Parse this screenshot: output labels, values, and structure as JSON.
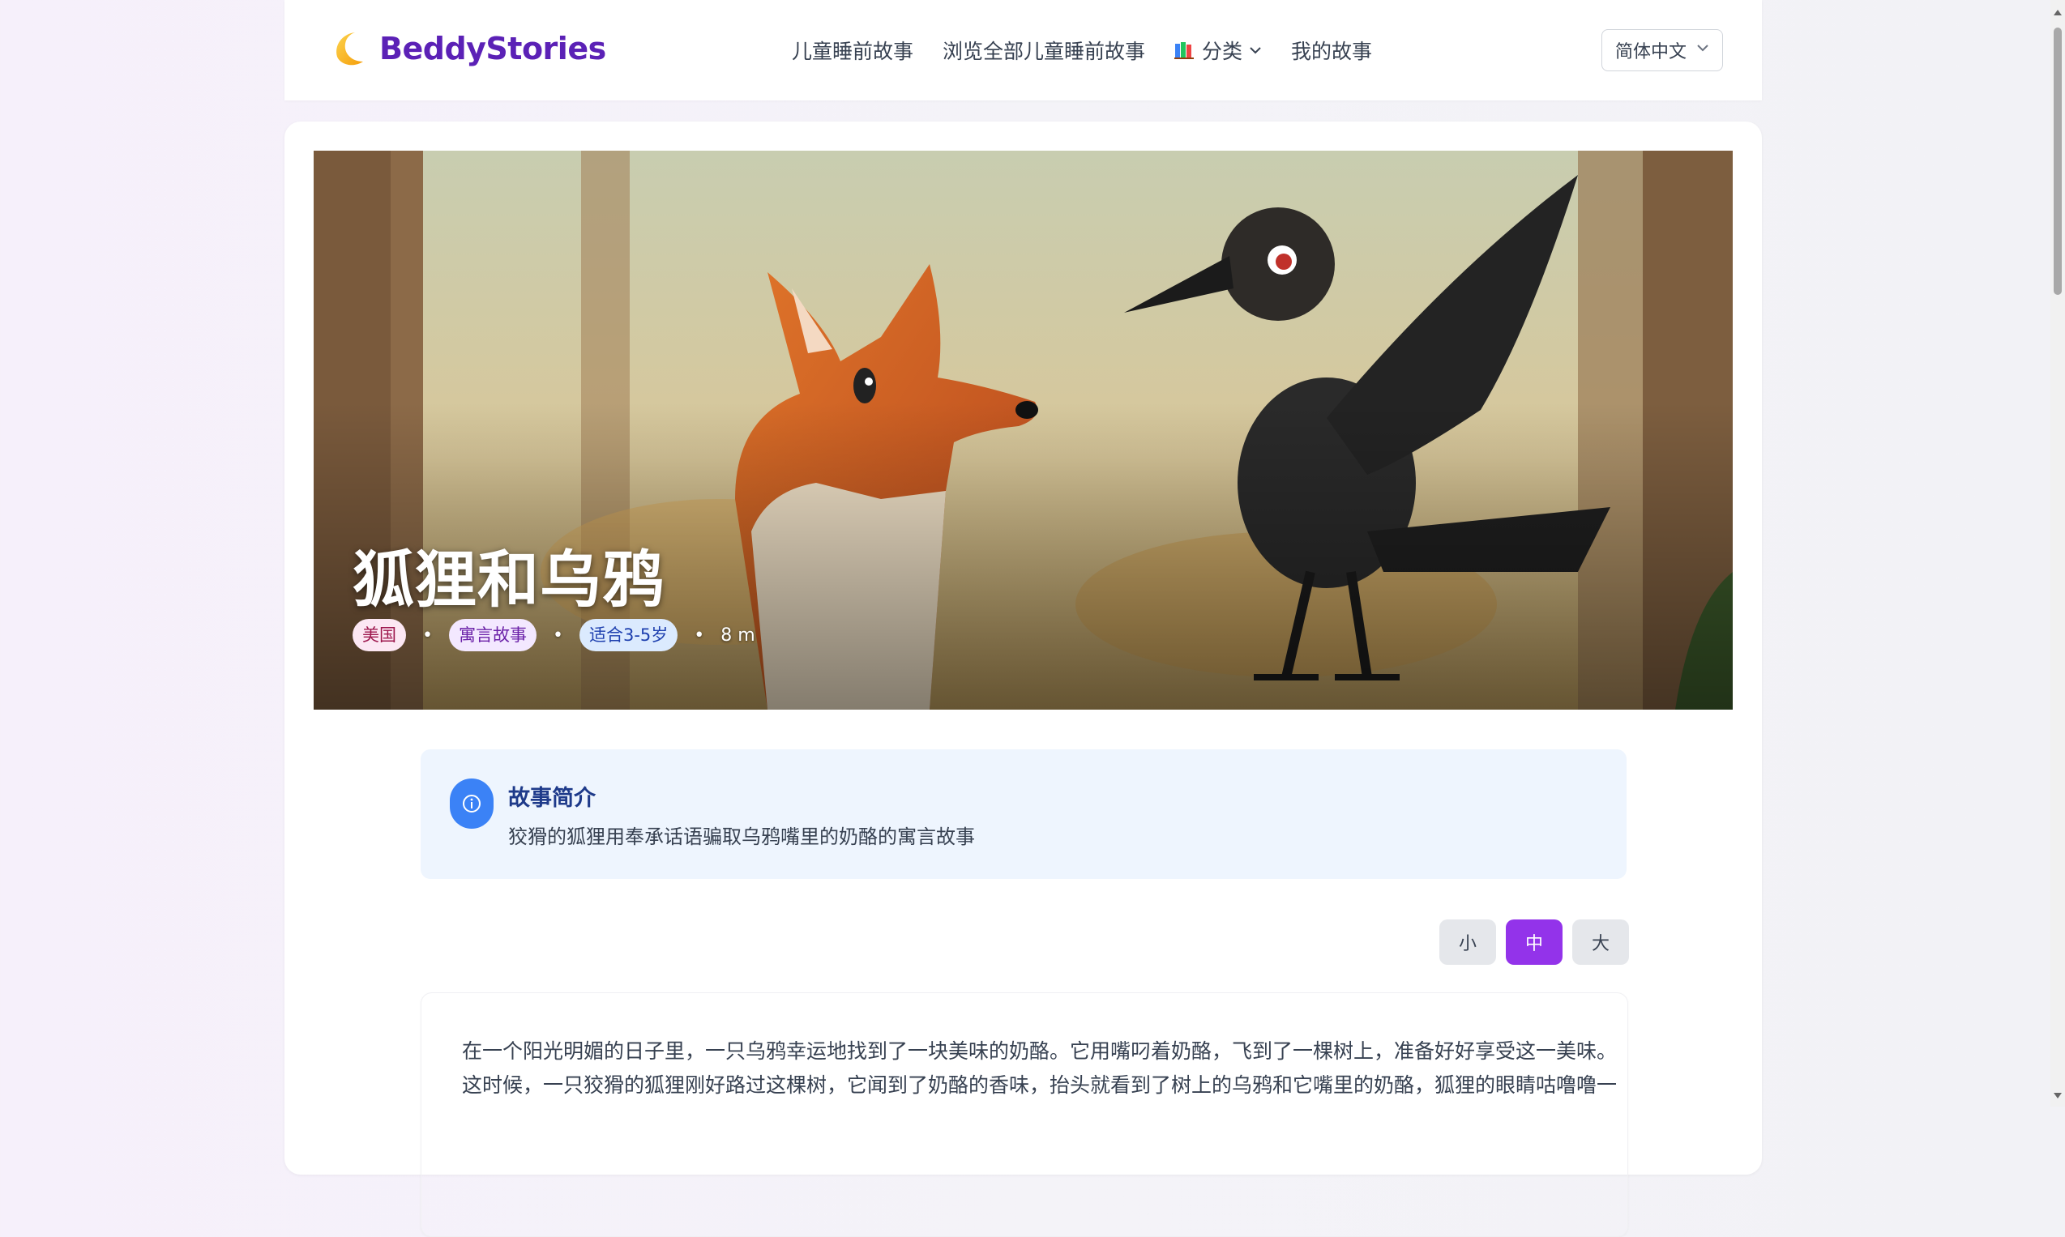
{
  "brand": {
    "name": "BeddyStories",
    "logo_icon": "crescent-moon-icon"
  },
  "nav": {
    "items": [
      {
        "label": "儿童睡前故事"
      },
      {
        "label": "浏览全部儿童睡前故事"
      },
      {
        "label": "分类",
        "icon": "books-icon",
        "has_dropdown": true
      },
      {
        "label": "我的故事"
      }
    ]
  },
  "language": {
    "selected": "简体中文"
  },
  "story": {
    "title": "狐狸和乌鸦",
    "tags": [
      "美国",
      "寓言故事",
      "适合3-5岁"
    ],
    "duration": "8 m",
    "hero_image": "Cartoon fox and crow in a forest"
  },
  "summary": {
    "heading": "故事简介",
    "text": "狡猾的狐狸用奉承话语骗取乌鸦嘴里的奶酪的寓言故事"
  },
  "font_size": {
    "options": [
      "小",
      "中",
      "大"
    ],
    "selected": "中"
  },
  "content": {
    "lines": [
      "在一个阳光明媚的日子里，一只乌鸦幸运地找到了一块美味的奶酪。它用嘴叼着奶酪，飞到了一棵树上，准备好好享受这一美味。",
      "这时候，一只狡猾的狐狸刚好路过这棵树，它闻到了奶酪的香味，抬头就看到了树上的乌鸦和它嘴里的奶酪，狐狸的眼睛咕噜噜一"
    ]
  },
  "colors": {
    "brand": "#5b21b6",
    "active_button": "#9333ea",
    "info": "#3b82f6",
    "summary_bg": "#eef5fe"
  }
}
